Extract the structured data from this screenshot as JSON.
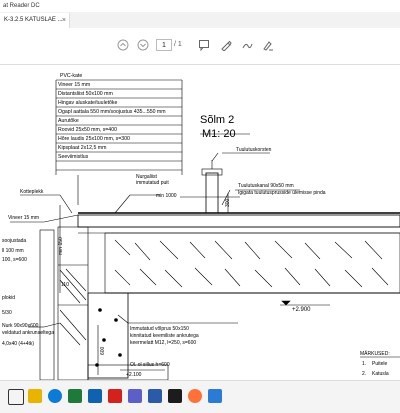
{
  "window": {
    "title": "at Reader DC"
  },
  "tabs": [
    {
      "label": "K-3.2.5 KATUSLAE ...",
      "close": "×"
    }
  ],
  "toolbar": {
    "page_current": "1",
    "page_total": "/ 1"
  },
  "drawing": {
    "layers": [
      "PVC-kate",
      "Vineer 15 mm",
      "Distantsliist 50x100 mm",
      "Hingav aluskate/tuuletõke",
      "Ogapl aattala 550 mm/soojustus 435...550 mm",
      "Aurutõke",
      "Roovid 25x50 mm, s=400",
      "Hõre laudis 25x100 mm, s=300",
      "Kipsplaat 2x12,5 mm",
      "Seeviimistlus"
    ],
    "title": "Sõlm 2",
    "scale": "M1: 20",
    "labels": {
      "ventilation_chimney": "Tuulutuskorsten",
      "nurgaliist": "Nurgaliist",
      "immutatud_puit": "immutatud puit",
      "min1000": "min 1000",
      "kotteplekk": "Kotteplekk",
      "vineer": "Vineer 15 mm",
      "tuulutuskanal": "Tuulutuskanal 90x50 mm",
      "tuulutuskanal_note": "Igigata tuulutusprusside ülemisse pinda",
      "soojustada": "soojustada",
      "ll100": "ll 100 mm",
      "s600": "100, s=600",
      "plokid": "plokid",
      "fraction": "5/30",
      "nurk": "Nurk 90x90x600",
      "veldatud": "veldatud ankrunaeltega",
      "x440": "4,0x40 (4+4tk)",
      "voolprus": "Immutatud võlprus 50x150",
      "kinnitatud": "kinnitatud keemiliste ankrutega",
      "keermelatt": "keermelatt M12, l=250, s=600",
      "ol_sillus": "Ol. ol sillus h=600",
      "elev1": "+2.900",
      "elev2": "+2.100",
      "dim110": "110",
      "dim150": "min 150",
      "dim300": "300",
      "dim600": "600",
      "markused": "MÄRKUSED:",
      "note1_num": "1.",
      "note1": "Puitele",
      "note2_num": "2.",
      "note2": "Katusla"
    }
  },
  "taskbar": {
    "apps": [
      {
        "name": "task-view",
        "color": "#333"
      },
      {
        "name": "file-explorer",
        "color": "#e8b400"
      },
      {
        "name": "edge",
        "color": "#0a7bd6"
      },
      {
        "name": "excel",
        "color": "#1e7a3a"
      },
      {
        "name": "outlook",
        "color": "#0f62b0"
      },
      {
        "name": "acrobat",
        "color": "#d4211c"
      },
      {
        "name": "teams",
        "color": "#5b5fc7"
      },
      {
        "name": "word",
        "color": "#2a5aa8"
      },
      {
        "name": "app-3d",
        "color": "#1c1c1c"
      },
      {
        "name": "firefox",
        "color": "#ff7139"
      },
      {
        "name": "other",
        "color": "#2a7bd6"
      }
    ]
  }
}
